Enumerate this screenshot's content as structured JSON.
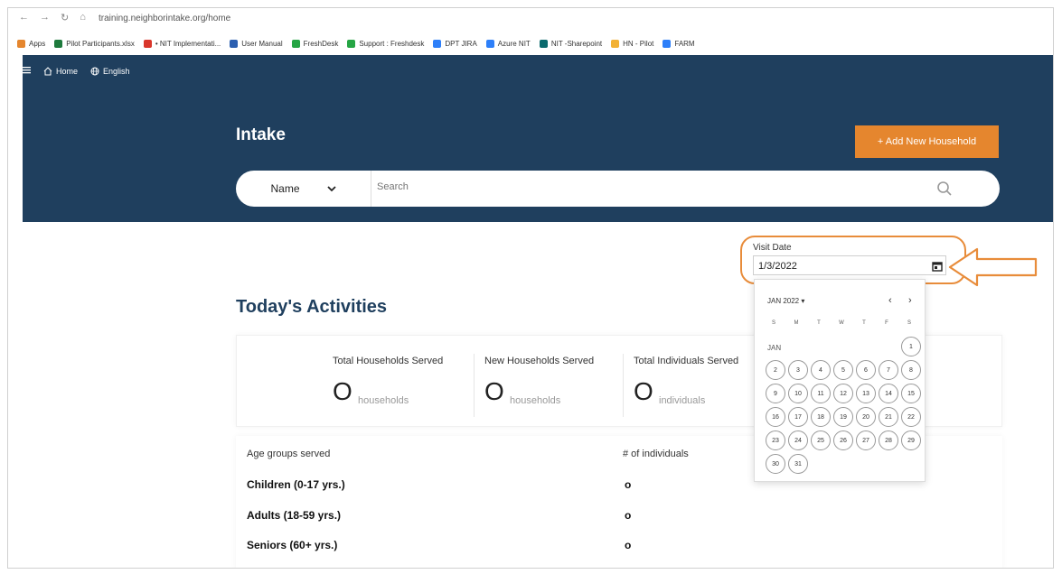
{
  "browser": {
    "url": "training.neighborintake.org/home",
    "bookmarks": [
      {
        "label": "Apps",
        "color": "#e5862e"
      },
      {
        "label": "Pilot Participants.xlsx",
        "color": "#1e7a3d"
      },
      {
        "label": "• NIT Implementati...",
        "color": "#d9362b"
      },
      {
        "label": "User Manual",
        "color": "#2b5fb0"
      },
      {
        "label": "FreshDesk",
        "color": "#25a544"
      },
      {
        "label": "Support : Freshdesk",
        "color": "#25a544"
      },
      {
        "label": "DPT JIRA",
        "color": "#2d7ff9"
      },
      {
        "label": "Azure NIT",
        "color": "#2d7ff9"
      },
      {
        "label": "NIT -Sharepoint",
        "color": "#0b6a6e"
      },
      {
        "label": "HN - Pilot",
        "color": "#f2b134"
      },
      {
        "label": "FARM",
        "color": "#2d7ff9"
      }
    ]
  },
  "topnav": {
    "home": "Home",
    "language": "English"
  },
  "header": {
    "title": "Intake",
    "add_button": "+ Add New Household",
    "search_type": "Name",
    "search_placeholder": "Search"
  },
  "visit": {
    "label": "Visit Date",
    "value": "1/3/2022"
  },
  "activities": {
    "title": "Today's Activities",
    "stats": [
      {
        "label": "Total Households Served",
        "value": "O",
        "unit": "households"
      },
      {
        "label": "New Households Served",
        "value": "O",
        "unit": "households"
      },
      {
        "label": "Total Individuals Served",
        "value": "O",
        "unit": "individuals"
      }
    ],
    "age_header": "Age groups served",
    "count_header": "# of individuals",
    "age_groups": [
      {
        "label": "Children (0-17 yrs.)",
        "value": "o"
      },
      {
        "label": "Adults (18-59 yrs.)",
        "value": "o"
      },
      {
        "label": "Seniors (60+ yrs.)",
        "value": "o"
      }
    ]
  },
  "calendar": {
    "month": "JAN 2022 ▾",
    "prev": "‹",
    "next": "›",
    "weekdays": [
      "S",
      "M",
      "T",
      "W",
      "T",
      "F",
      "S"
    ],
    "month_label": "JAN",
    "days": [
      "1",
      "2",
      "3",
      "4",
      "5",
      "6",
      "7",
      "8",
      "9",
      "10",
      "11",
      "12",
      "13",
      "14",
      "15",
      "16",
      "17",
      "18",
      "19",
      "20",
      "21",
      "22",
      "23",
      "24",
      "25",
      "26",
      "27",
      "28",
      "29",
      "30",
      "31"
    ]
  },
  "accent": "#e5862e",
  "brand": "#1f3f5e"
}
